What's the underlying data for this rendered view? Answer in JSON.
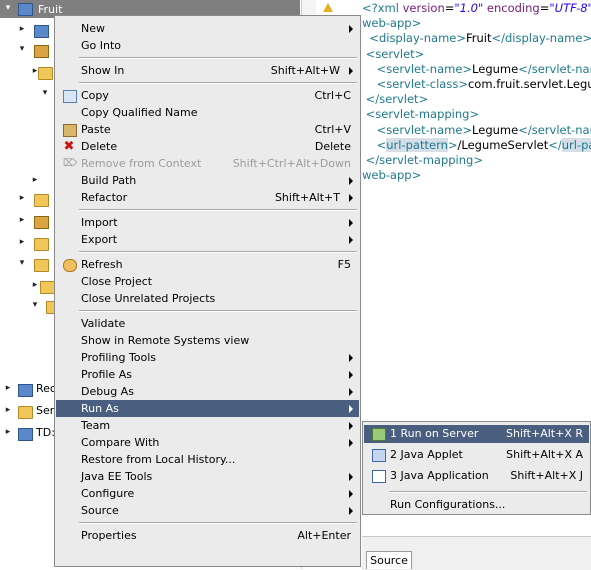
{
  "project_tree": {
    "header_title": "Fruit",
    "items": [
      {
        "label": "Rec"
      },
      {
        "label": "Ser"
      },
      {
        "label": "TD:"
      }
    ]
  },
  "editor": {
    "lines": [
      {
        "parts": [
          {
            "t": "tag",
            "v": "<?xml "
          },
          {
            "t": "attr",
            "v": "version"
          },
          {
            "t": "txt",
            "v": "="
          },
          {
            "t": "str",
            "v": "\"1.0\""
          },
          {
            "t": "attr",
            "v": " encoding"
          },
          {
            "t": "txt",
            "v": "="
          },
          {
            "t": "str",
            "v": "\"UTF-8\""
          },
          {
            "t": "tag",
            "v": "?>"
          }
        ]
      },
      {
        "parts": [
          {
            "t": "tag",
            "v": "web-app>"
          }
        ]
      },
      {
        "parts": [
          {
            "t": "tag",
            "v": "  <display-name>"
          },
          {
            "t": "txt",
            "v": "Fruit"
          },
          {
            "t": "tag",
            "v": "</display-name>"
          }
        ]
      },
      {
        "parts": [
          {
            "t": "tag",
            "v": " <servlet>"
          }
        ]
      },
      {
        "parts": [
          {
            "t": "tag",
            "v": "    <servlet-name>"
          },
          {
            "t": "txt",
            "v": "Legume"
          },
          {
            "t": "tag",
            "v": "</servlet-nam"
          }
        ]
      },
      {
        "parts": [
          {
            "t": "tag",
            "v": "    <servlet-class>"
          },
          {
            "t": "txt",
            "v": "com.fruit.servlet.Legum"
          }
        ]
      },
      {
        "parts": [
          {
            "t": "tag",
            "v": " </servlet>"
          }
        ]
      },
      {
        "parts": [
          {
            "t": "tag",
            "v": " <servlet-mapping>"
          }
        ]
      },
      {
        "parts": [
          {
            "t": "tag",
            "v": "    <servlet-name>"
          },
          {
            "t": "txt",
            "v": "Legume"
          },
          {
            "t": "tag",
            "v": "</servlet-nam"
          }
        ]
      },
      {
        "parts": [
          {
            "t": "tag",
            "v": "    <"
          },
          {
            "t": "hl",
            "v": "url-pattern"
          },
          {
            "t": "tag",
            "v": ">"
          },
          {
            "t": "txt",
            "v": "/LegumeServlet"
          },
          {
            "t": "tag",
            "v": "</"
          },
          {
            "t": "hl",
            "v": "url-pat"
          }
        ]
      },
      {
        "parts": [
          {
            "t": "tag",
            "v": " </servlet-mapping>"
          }
        ]
      },
      {
        "parts": [
          {
            "t": "tag",
            "v": "web-app>"
          }
        ]
      }
    ],
    "bottom_tab": "Source"
  },
  "context_menu": {
    "items": [
      {
        "label": "New",
        "arrow": true
      },
      {
        "label": "Go Into"
      },
      {
        "sep": true
      },
      {
        "label": "Show In",
        "shortcut": "Shift+Alt+W",
        "arrow": true
      },
      {
        "sep": true
      },
      {
        "label": "Copy",
        "shortcut": "Ctrl+C",
        "icon": "copy-icon"
      },
      {
        "label": "Copy Qualified Name"
      },
      {
        "label": "Paste",
        "shortcut": "Ctrl+V",
        "icon": "paste-icon"
      },
      {
        "label": "Delete",
        "shortcut": "Delete",
        "icon": "delete-icon"
      },
      {
        "label": "Remove from Context",
        "shortcut": "Shift+Ctrl+Alt+Down",
        "disabled": true,
        "icon": "remove-context-icon"
      },
      {
        "label": "Build Path",
        "arrow": true
      },
      {
        "label": "Refactor",
        "shortcut": "Shift+Alt+T",
        "arrow": true
      },
      {
        "sep": true
      },
      {
        "label": "Import",
        "arrow": true
      },
      {
        "label": "Export",
        "arrow": true
      },
      {
        "sep": true
      },
      {
        "label": "Refresh",
        "shortcut": "F5",
        "icon": "refresh-icon"
      },
      {
        "label": "Close Project"
      },
      {
        "label": "Close Unrelated Projects"
      },
      {
        "sep": true
      },
      {
        "label": "Validate"
      },
      {
        "label": "Show in Remote Systems view"
      },
      {
        "label": "Profiling Tools",
        "arrow": true
      },
      {
        "label": "Profile As",
        "arrow": true
      },
      {
        "label": "Debug As",
        "arrow": true
      },
      {
        "label": "Run As",
        "arrow": true,
        "active": true
      },
      {
        "label": "Team",
        "arrow": true
      },
      {
        "label": "Compare With",
        "arrow": true
      },
      {
        "label": "Restore from Local History..."
      },
      {
        "label": "Java EE Tools",
        "arrow": true
      },
      {
        "label": "Configure",
        "arrow": true
      },
      {
        "label": "Source",
        "arrow": true
      },
      {
        "sep": true
      },
      {
        "label": "Properties",
        "shortcut": "Alt+Enter"
      }
    ]
  },
  "run_as_submenu": {
    "items": [
      {
        "label": "1 Run on Server",
        "shortcut": "Shift+Alt+X R",
        "icon": "server-icon",
        "active": true
      },
      {
        "label": "2 Java Applet",
        "shortcut": "Shift+Alt+X A",
        "icon": "java-applet-icon"
      },
      {
        "label": "3 Java Application",
        "shortcut": "Shift+Alt+X J",
        "icon": "java-application-icon"
      },
      {
        "sep": true
      },
      {
        "label": "Run Configurations..."
      }
    ]
  }
}
